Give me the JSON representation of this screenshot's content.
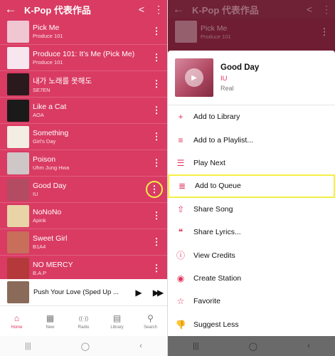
{
  "left": {
    "app_title": "K-Pop 代表作品",
    "tracks": [
      {
        "title": "Pick Me",
        "artist": "Produce 101",
        "color": "#f1c6d3"
      },
      {
        "title": "Produce 101: It's Me (Pick Me)",
        "artist": "Produce 101",
        "color": "#f7e6ee"
      },
      {
        "title": "내가 노래를 못해도",
        "artist": "SE7EN",
        "color": "#2a1a1e"
      },
      {
        "title": "Like a Cat",
        "artist": "AOA",
        "color": "#1a1a1a"
      },
      {
        "title": "Something",
        "artist": "Girl's Day",
        "color": "#f4ede4"
      },
      {
        "title": "Poison",
        "artist": "Uhm Jung Hwa",
        "color": "#cfc6c8"
      },
      {
        "title": "Good Day",
        "artist": "IU",
        "color": "#b34b63"
      },
      {
        "title": "NoNoNo",
        "artist": "Apink",
        "color": "#e9d4a7"
      },
      {
        "title": "Sweet Girl",
        "artist": "B1A4",
        "color": "#c86e5a"
      },
      {
        "title": "NO MERCY",
        "artist": "B.A.P",
        "color": "#b5393b"
      }
    ],
    "now_playing": "Push Your Love (Sped Up ...",
    "tabs": [
      {
        "label": "Home",
        "icon": "⌂"
      },
      {
        "label": "New",
        "icon": "▦"
      },
      {
        "label": "Radio",
        "icon": "((·))"
      },
      {
        "label": "Library",
        "icon": "▤"
      },
      {
        "label": "Search",
        "icon": "⚲"
      }
    ]
  },
  "right": {
    "dim_title": "K-Pop 代表作品",
    "dim_track": {
      "title": "Pick Me",
      "artist": "Produce 101"
    },
    "song": {
      "title": "Good Day",
      "artist": "IU",
      "album": "Real"
    },
    "menu": [
      {
        "label": "Add to Library",
        "icon": "+"
      },
      {
        "label": "Add to a Playlist...",
        "icon": "≡"
      },
      {
        "label": "Play Next",
        "icon": "☰"
      },
      {
        "label": "Add to Queue",
        "icon": "≣"
      },
      {
        "label": "Share Song",
        "icon": "⇧"
      },
      {
        "label": "Share Lyrics...",
        "icon": "❝"
      },
      {
        "label": "View Credits",
        "icon": "ⓘ"
      },
      {
        "label": "Create Station",
        "icon": "◉"
      },
      {
        "label": "Favorite",
        "icon": "☆"
      },
      {
        "label": "Suggest Less",
        "icon": "👎"
      }
    ]
  },
  "colors": {
    "accent": "#e2345c",
    "playlist_bg": "#d93b63",
    "highlight": "#f6f047"
  }
}
